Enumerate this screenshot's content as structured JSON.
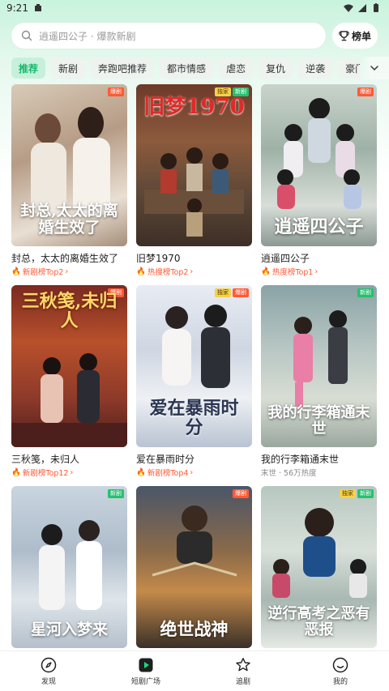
{
  "status": {
    "time": "9:21"
  },
  "search": {
    "placeholder": "逍遥四公子 · 爆款新剧",
    "rank_label": "榜单"
  },
  "tabs": [
    "推荐",
    "新剧",
    "奔跑吧推荐",
    "都市情感",
    "虐恋",
    "复仇",
    "逆袭",
    "豪门"
  ],
  "cards": [
    {
      "title": "封总，太太的离婚生效了",
      "sub": "新剧榜Top2",
      "art": "封总,太太的离婚生效了",
      "badges": [
        "爆剧"
      ],
      "hot": true
    },
    {
      "title": "旧梦1970",
      "sub": "热搜榜Top2",
      "art": "旧梦1970",
      "badges": [
        "独家",
        "新剧"
      ],
      "hot": true
    },
    {
      "title": "逍遥四公子",
      "sub": "热度榜Top1",
      "art": "逍遥四公子",
      "badges": [
        "爆剧"
      ],
      "hot": true
    },
    {
      "title": "三秋笺，未归人",
      "sub": "新剧榜Top12",
      "art": "三秋笺,未归人",
      "badges": [
        "爆剧"
      ],
      "hot": true
    },
    {
      "title": "爱在暴雨时分",
      "sub": "新剧榜Top4",
      "art": "爱在暴雨时分",
      "badges": [
        "独家",
        "爆剧"
      ],
      "hot": true
    },
    {
      "title": "我的行李箱通末世",
      "sub": "末世 · 56万热度",
      "art": "我的行李箱通末世",
      "badges": [
        "新剧"
      ],
      "hot": false
    },
    {
      "title": "",
      "sub": "",
      "art": "星河入梦来",
      "badges": [
        "新剧"
      ],
      "hot": false
    },
    {
      "title": "",
      "sub": "",
      "art": "绝世战神",
      "badges": [
        "爆剧"
      ],
      "hot": false
    },
    {
      "title": "",
      "sub": "",
      "art": "逆行高考之恶有恶报",
      "badges": [
        "独家",
        "新剧"
      ],
      "hot": false
    }
  ],
  "nav": [
    {
      "label": "发现",
      "icon": "compass-icon"
    },
    {
      "label": "短剧广场",
      "icon": "play-square-icon"
    },
    {
      "label": "追剧",
      "icon": "star-icon"
    },
    {
      "label": "我的",
      "icon": "smile-face-icon"
    }
  ],
  "colors": {
    "accent": "#13b96b",
    "hot": "#ff5a36",
    "new": "#27c06f",
    "exclusive": "#f6d24a"
  }
}
